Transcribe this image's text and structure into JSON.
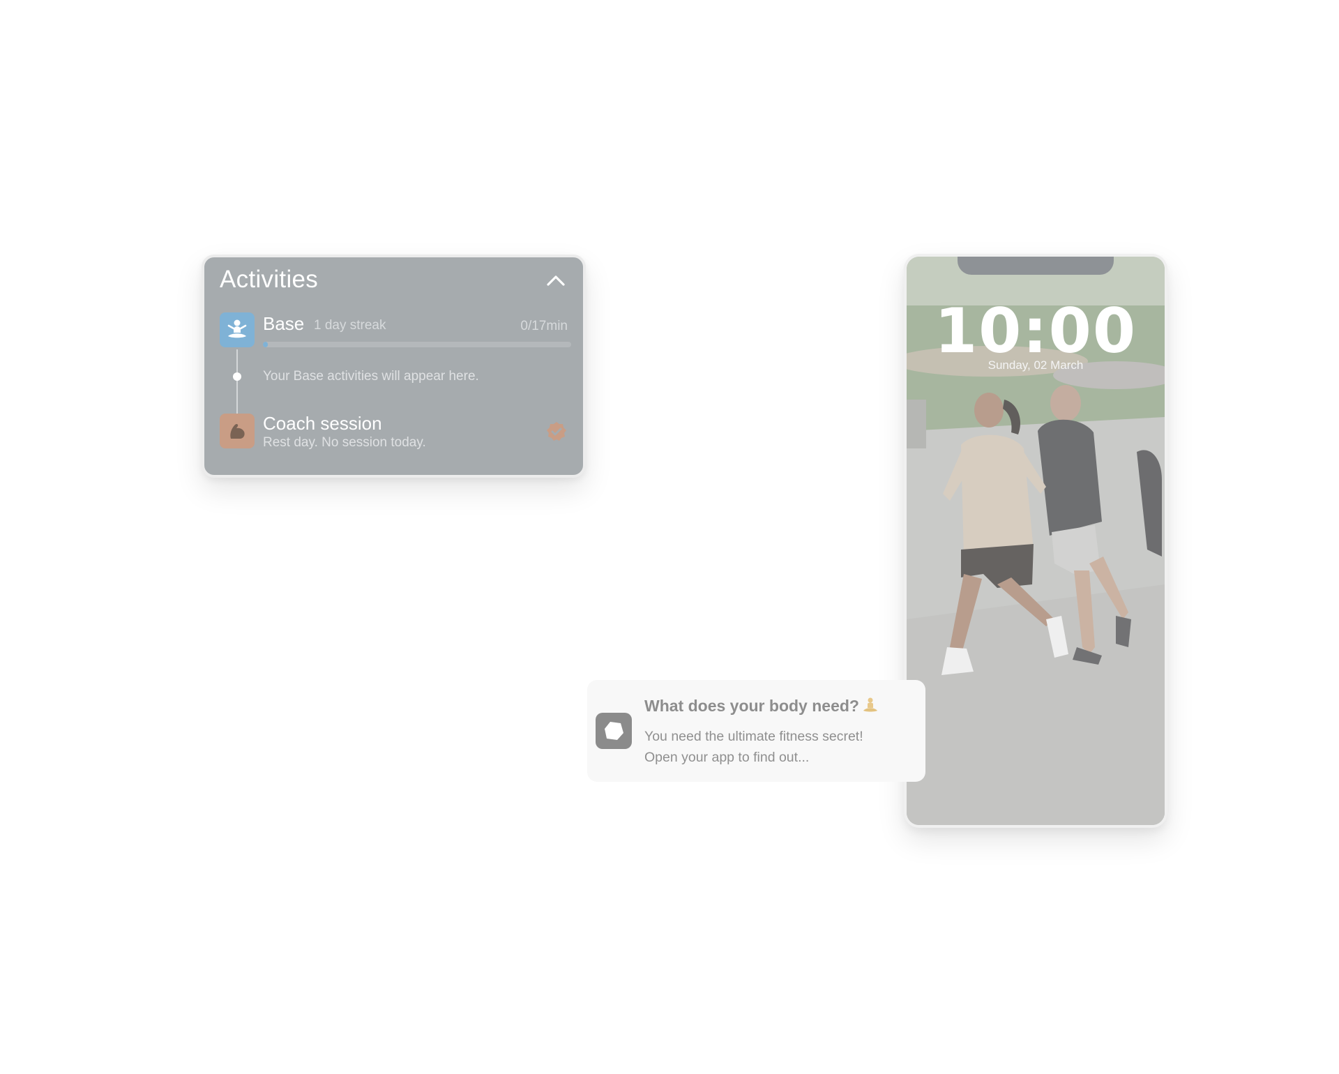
{
  "activities_card": {
    "title": "Activities",
    "base": {
      "label": "Base",
      "streak": "1 day streak",
      "progress_text": "0/17min",
      "progress_fraction": 0.015,
      "empty_text": "Your Base activities will appear here."
    },
    "coach": {
      "label": "Coach session",
      "subtitle": "Rest day. No session today."
    },
    "icons": {
      "collapse": "chevron-up-icon",
      "base": "meditation-icon",
      "coach": "flexed-arm-icon",
      "coach_status": "verified-check-icon"
    }
  },
  "notification": {
    "title": "What does your body need?",
    "title_emoji": "person-in-lotus-position-emoji",
    "body_line1": "You need the ultimate fitness secret!",
    "body_line2": "Open your app to find out..."
  },
  "lock_screen": {
    "time": "10:00",
    "date": "Sunday, 02 March",
    "wallpaper": "people-running-in-park"
  },
  "colors": {
    "card_bg": "#a6abae",
    "base_accent": "#7fb2d6",
    "coach_accent": "#c99d85"
  }
}
